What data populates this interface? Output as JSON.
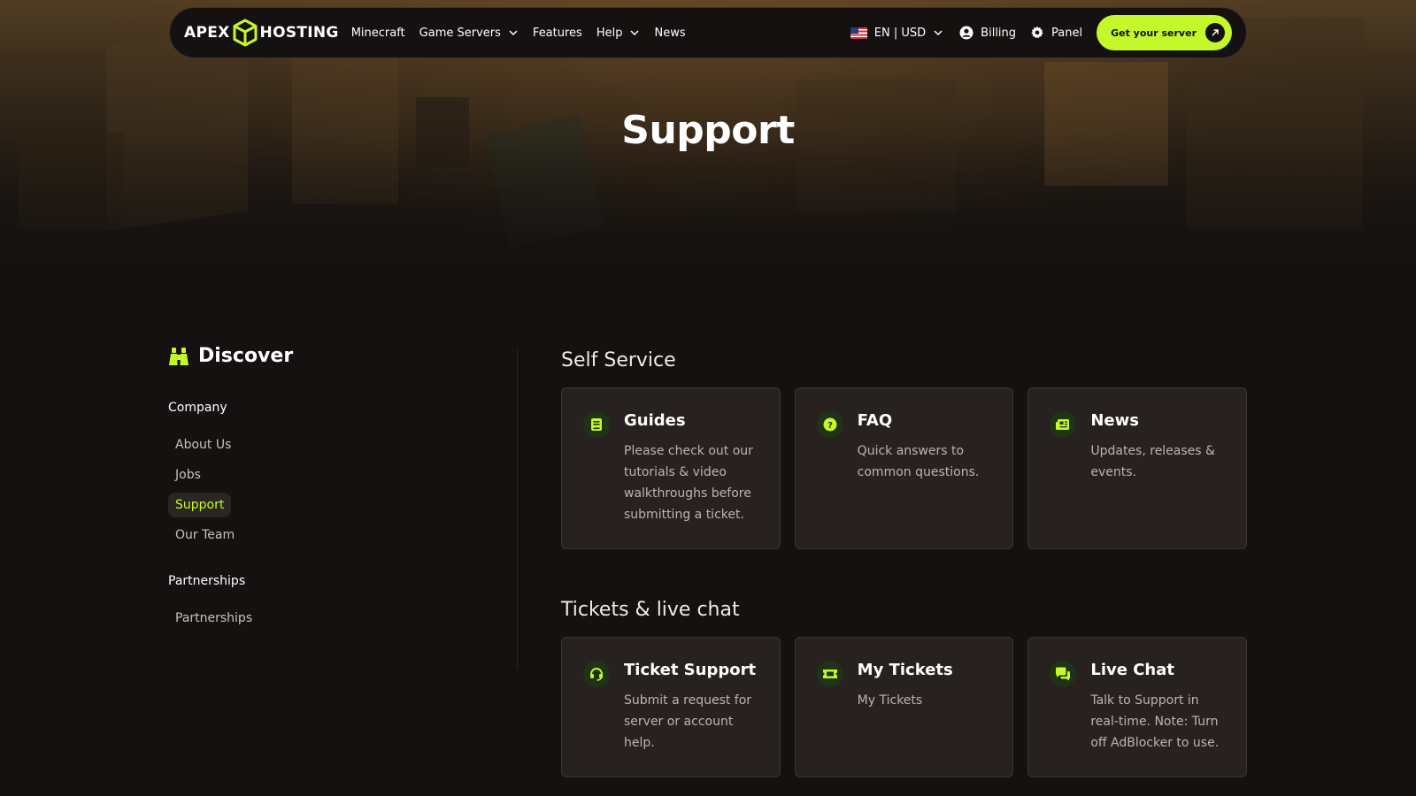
{
  "brand": {
    "logo_left": "APEX",
    "logo_right": "HOSTING",
    "accent_color": "#c5f82a"
  },
  "nav": {
    "links": [
      {
        "label": "Minecraft",
        "dropdown": false
      },
      {
        "label": "Game Servers",
        "dropdown": true
      },
      {
        "label": "Features",
        "dropdown": false
      },
      {
        "label": "Help",
        "dropdown": true
      },
      {
        "label": "News",
        "dropdown": false
      }
    ],
    "lang_currency": "EN | USD",
    "billing_label": "Billing",
    "panel_label": "Panel",
    "cta_label": "Get your server"
  },
  "hero": {
    "title": "Support"
  },
  "sidebar": {
    "heading": "Discover",
    "groups": [
      {
        "title": "Company",
        "items": [
          "About Us",
          "Jobs",
          "Support",
          "Our Team"
        ]
      },
      {
        "title": "Partnerships",
        "items": [
          "Partnerships"
        ]
      }
    ],
    "active_item": "Support"
  },
  "sections": [
    {
      "title": "Self Service",
      "cards": [
        {
          "icon": "book-icon",
          "title": "Guides",
          "text": "Please check out our tutorials & video walkthroughs before submitting a ticket."
        },
        {
          "icon": "question-icon",
          "title": "FAQ",
          "text": "Quick answers to common questions."
        },
        {
          "icon": "newspaper-icon",
          "title": "News",
          "text": "Updates, releases & events."
        }
      ]
    },
    {
      "title": "Tickets & live chat",
      "cards": [
        {
          "icon": "headset-icon",
          "title": "Ticket Support",
          "text": "Submit a request for server or account help."
        },
        {
          "icon": "ticket-icon",
          "title": "My Tickets",
          "text": "My Tickets"
        },
        {
          "icon": "chat-icon",
          "title": "Live Chat",
          "text": "Talk to Support in real-time. Note: Turn off AdBlocker to use."
        }
      ]
    }
  ]
}
